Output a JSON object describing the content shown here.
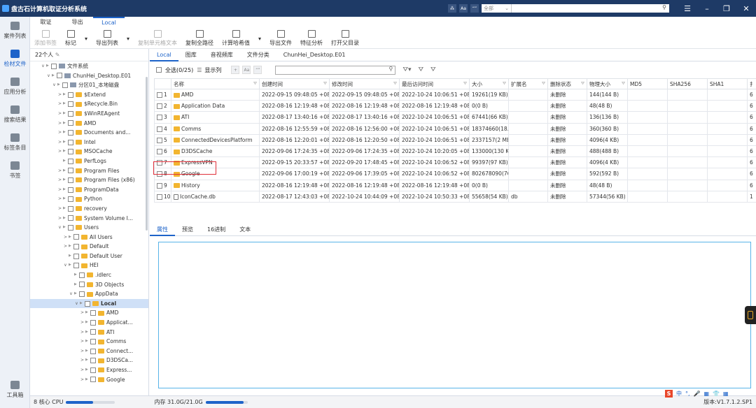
{
  "app": {
    "title": "盘古石计算机取证分析系统",
    "search_scope": "全部",
    "topbar_btns": [
      "⁂",
      "Aa",
      "“”"
    ]
  },
  "leftbar": {
    "items": [
      {
        "label": "案件列表",
        "icon": "case-icon",
        "active": false
      },
      {
        "label": "检材文件",
        "icon": "layers-icon",
        "active": true
      },
      {
        "label": "应用分析",
        "icon": "app-grid-icon",
        "active": false
      },
      {
        "label": "搜索结果",
        "icon": "search-result-icon",
        "active": false
      },
      {
        "label": "标签条目",
        "icon": "tag-icon",
        "active": false
      },
      {
        "label": "书签",
        "icon": "bookmark-icon",
        "active": false
      }
    ],
    "bottom": {
      "label": "工具箱",
      "icon": "toolbox-icon"
    }
  },
  "menu": {
    "tabs": [
      {
        "label": "取证",
        "active": false
      },
      {
        "label": "导出",
        "active": false
      },
      {
        "label": "Local",
        "active": true
      }
    ]
  },
  "toolbar": {
    "items": [
      {
        "label": "添加书签",
        "disabled": true,
        "dropdown": false,
        "icon": "bookmark-add-icon"
      },
      {
        "label": "标记",
        "disabled": false,
        "dropdown": true,
        "icon": "flag-icon"
      },
      {
        "label": "导出列表",
        "disabled": false,
        "dropdown": true,
        "icon": "export-list-icon"
      },
      {
        "label": "复制单元格文本",
        "disabled": true,
        "dropdown": false,
        "icon": "copy-cell-icon"
      },
      {
        "label": "复制全路径",
        "disabled": false,
        "dropdown": false,
        "icon": "copy-path-icon"
      },
      {
        "label": "计算哈希值",
        "disabled": false,
        "dropdown": true,
        "icon": "hash-icon"
      },
      {
        "label": "导出文件",
        "disabled": false,
        "dropdown": false,
        "icon": "export-file-icon"
      },
      {
        "label": "特征分析",
        "disabled": false,
        "dropdown": false,
        "icon": "feature-icon"
      },
      {
        "label": "打开父目录",
        "disabled": false,
        "dropdown": false,
        "icon": "open-parent-icon"
      }
    ]
  },
  "tree": {
    "header": "22个人",
    "rows": [
      {
        "label": "文件系统",
        "indent": 0,
        "type": "drive",
        "exp": "∨"
      },
      {
        "label": "ChunHei_Desktop.E01",
        "indent": 1,
        "type": "drive",
        "exp": "∨"
      },
      {
        "label": "分区01_本地磁盘",
        "indent": 2,
        "type": "drive",
        "exp": "∨"
      },
      {
        "label": "$Extend",
        "indent": 3,
        "type": "folder",
        "exp": ">"
      },
      {
        "label": "$Recycle.Bin",
        "indent": 3,
        "type": "folder",
        "exp": ">"
      },
      {
        "label": "$WinREAgent",
        "indent": 3,
        "type": "folder",
        "exp": ">"
      },
      {
        "label": "AMD",
        "indent": 3,
        "type": "folder",
        "exp": ">"
      },
      {
        "label": "Documents and...",
        "indent": 3,
        "type": "folder",
        "exp": ">"
      },
      {
        "label": "Intel",
        "indent": 3,
        "type": "folder",
        "exp": ">"
      },
      {
        "label": "MSOCache",
        "indent": 3,
        "type": "folder",
        "exp": ">"
      },
      {
        "label": "PerfLogs",
        "indent": 3,
        "type": "folder",
        "exp": ""
      },
      {
        "label": "Program Files",
        "indent": 3,
        "type": "folder",
        "exp": ">"
      },
      {
        "label": "Program Files (x86)",
        "indent": 3,
        "type": "folder",
        "exp": ">"
      },
      {
        "label": "ProgramData",
        "indent": 3,
        "type": "folder",
        "exp": ">"
      },
      {
        "label": "Python",
        "indent": 3,
        "type": "folder",
        "exp": ">"
      },
      {
        "label": "recovery",
        "indent": 3,
        "type": "folder",
        "exp": ">"
      },
      {
        "label": "System Volume I...",
        "indent": 3,
        "type": "folder",
        "exp": ">"
      },
      {
        "label": "Users",
        "indent": 3,
        "type": "folder",
        "exp": "∨"
      },
      {
        "label": "All Users",
        "indent": 4,
        "type": "folder",
        "exp": ">"
      },
      {
        "label": "Default",
        "indent": 4,
        "type": "folder",
        "exp": ">"
      },
      {
        "label": "Default User",
        "indent": 4,
        "type": "folder",
        "exp": ""
      },
      {
        "label": "HEI",
        "indent": 4,
        "type": "folder",
        "exp": "∨"
      },
      {
        "label": ".idlerc",
        "indent": 5,
        "type": "folder",
        "exp": ""
      },
      {
        "label": "3D Objects",
        "indent": 5,
        "type": "folder",
        "exp": ""
      },
      {
        "label": "AppData",
        "indent": 5,
        "type": "folder",
        "exp": "∨"
      },
      {
        "label": "Local",
        "indent": 6,
        "type": "folder",
        "exp": "∨",
        "selected": true
      },
      {
        "label": "AMD",
        "indent": 7,
        "type": "folder",
        "exp": ">"
      },
      {
        "label": "Applicat...",
        "indent": 7,
        "type": "folder",
        "exp": ">"
      },
      {
        "label": "ATI",
        "indent": 7,
        "type": "folder",
        "exp": ">"
      },
      {
        "label": "Comms",
        "indent": 7,
        "type": "folder",
        "exp": ">"
      },
      {
        "label": "Connect...",
        "indent": 7,
        "type": "folder",
        "exp": ">"
      },
      {
        "label": "D3DSCa...",
        "indent": 7,
        "type": "folder",
        "exp": ">"
      },
      {
        "label": "Express...",
        "indent": 7,
        "type": "folder",
        "exp": ">"
      },
      {
        "label": "Google",
        "indent": 7,
        "type": "folder",
        "exp": ">"
      }
    ]
  },
  "subtabs": [
    {
      "label": "Local",
      "active": true
    },
    {
      "label": "图库",
      "active": false
    },
    {
      "label": "音视频库",
      "active": false
    },
    {
      "label": "文件分类",
      "active": false
    },
    {
      "label": "ChunHei_Desktop.E01",
      "active": false
    }
  ],
  "filterbar": {
    "select_all": "全选(0/25)",
    "show_cols": "显示列",
    "btn_labels": [
      "+",
      "Aa",
      "“”"
    ],
    "search_placeholder": ""
  },
  "table": {
    "columns": [
      {
        "label": "",
        "w": 24,
        "f": false
      },
      {
        "label": "名称",
        "w": 126,
        "f": true
      },
      {
        "label": "创建时间",
        "w": 100,
        "f": true
      },
      {
        "label": "修改时间",
        "w": 100,
        "f": true
      },
      {
        "label": "最后访问时间",
        "w": 100,
        "f": true
      },
      {
        "label": "大小",
        "w": 56,
        "f": true
      },
      {
        "label": "扩展名",
        "w": 56,
        "f": true
      },
      {
        "label": "删除状态",
        "w": 56,
        "f": true
      },
      {
        "label": "物理大小",
        "w": 58,
        "f": true
      },
      {
        "label": "MD5",
        "w": 57,
        "f": false
      },
      {
        "label": "SHA256",
        "w": 57,
        "f": false
      },
      {
        "label": "SHA1",
        "w": 57,
        "f": false
      },
      {
        "label": "扌",
        "w": 19,
        "f": false
      }
    ],
    "rows": [
      {
        "n": "1",
        "name": "AMD",
        "type": "folder",
        "c": "2022-09-15 09:48:05 +08",
        "m": "2022-09-15 09:48:05 +08",
        "a": "2022-10-24 10:06:51 +08",
        "size": "19261(19 KB)",
        "ext": "",
        "del": "未删除",
        "phys": "144(144 B)",
        "last": "6"
      },
      {
        "n": "2",
        "name": "Application Data",
        "type": "folder",
        "c": "2022-08-16 12:19:48 +08",
        "m": "2022-08-16 12:19:48 +08",
        "a": "2022-08-16 12:19:48 +08",
        "size": "0(0 B)",
        "ext": "",
        "del": "未删除",
        "phys": "48(48 B)",
        "last": "6"
      },
      {
        "n": "3",
        "name": "ATI",
        "type": "folder",
        "c": "2022-08-17 13:40:16 +08",
        "m": "2022-08-17 13:40:16 +08",
        "a": "2022-10-24 10:06:51 +08",
        "size": "67441(66 KB)",
        "ext": "",
        "del": "未删除",
        "phys": "136(136 B)",
        "last": "6"
      },
      {
        "n": "4",
        "name": "Comms",
        "type": "folder",
        "c": "2022-08-16 12:55:59 +08",
        "m": "2022-08-16 12:56:00 +08",
        "a": "2022-10-24 10:06:51 +08",
        "size": "18374660(18...",
        "ext": "",
        "del": "未删除",
        "phys": "360(360 B)",
        "last": "6"
      },
      {
        "n": "5",
        "name": "ConnectedDevicesPlatform",
        "type": "folder",
        "c": "2022-08-16 12:20:01 +08",
        "m": "2022-08-16 12:20:50 +08",
        "a": "2022-10-24 10:06:51 +08",
        "size": "2337157(2 MB)",
        "ext": "",
        "del": "未删除",
        "phys": "4096(4 KB)",
        "last": "6"
      },
      {
        "n": "6",
        "name": "D3DSCache",
        "type": "folder",
        "c": "2022-09-06 17:24:35 +08",
        "m": "2022-09-06 17:24:35 +08",
        "a": "2022-10-24 10:20:05 +08",
        "size": "133000(130 KB)",
        "ext": "",
        "del": "未删除",
        "phys": "488(488 B)",
        "last": "6"
      },
      {
        "n": "7",
        "name": "ExpressVPN",
        "type": "folder",
        "c": "2022-09-15 20:33:57 +08",
        "m": "2022-09-20 17:48:45 +08",
        "a": "2022-10-24 10:06:52 +08",
        "size": "99397(97 KB)",
        "ext": "",
        "del": "未删除",
        "phys": "4096(4 KB)",
        "last": "6"
      },
      {
        "n": "8",
        "name": "Google",
        "type": "folder",
        "c": "2022-09-06 17:00:19 +08",
        "m": "2022-09-06 17:39:05 +08",
        "a": "2022-10-24 10:06:52 +08",
        "size": "802678090(76...",
        "ext": "",
        "del": "未删除",
        "phys": "592(592 B)",
        "last": "6"
      },
      {
        "n": "9",
        "name": "History",
        "type": "folder",
        "c": "2022-08-16 12:19:48 +08",
        "m": "2022-08-16 12:19:48 +08",
        "a": "2022-08-16 12:19:48 +08",
        "size": "0(0 B)",
        "ext": "",
        "del": "未删除",
        "phys": "48(48 B)",
        "last": "6"
      },
      {
        "n": "10",
        "name": "IconCache.db",
        "type": "file",
        "c": "2022-08-17 12:43:03 +08",
        "m": "2022-10-24 10:44:09 +08",
        "a": "2022-10-24 10:50:33 +08",
        "size": "55658(54 KB)",
        "ext": "db",
        "del": "未删除",
        "phys": "57344(56 KB)",
        "last": "1"
      }
    ]
  },
  "bottomtabs": [
    {
      "label": "属性",
      "active": true
    },
    {
      "label": "预览",
      "active": false
    },
    {
      "label": "16进制",
      "active": false
    },
    {
      "label": "文本",
      "active": false
    }
  ],
  "status": {
    "cpu_label": "8 核心 CPU",
    "cpu_fraction": 0.55,
    "mem_label": "内存 31.0G/21.0G",
    "mem_fraction": 0.9,
    "version": "版本:V1.7.1.2.SP1"
  },
  "ime": {
    "brand": "S",
    "items": [
      "中",
      "°,",
      "🎤",
      "▦",
      "👕",
      "▦"
    ]
  }
}
